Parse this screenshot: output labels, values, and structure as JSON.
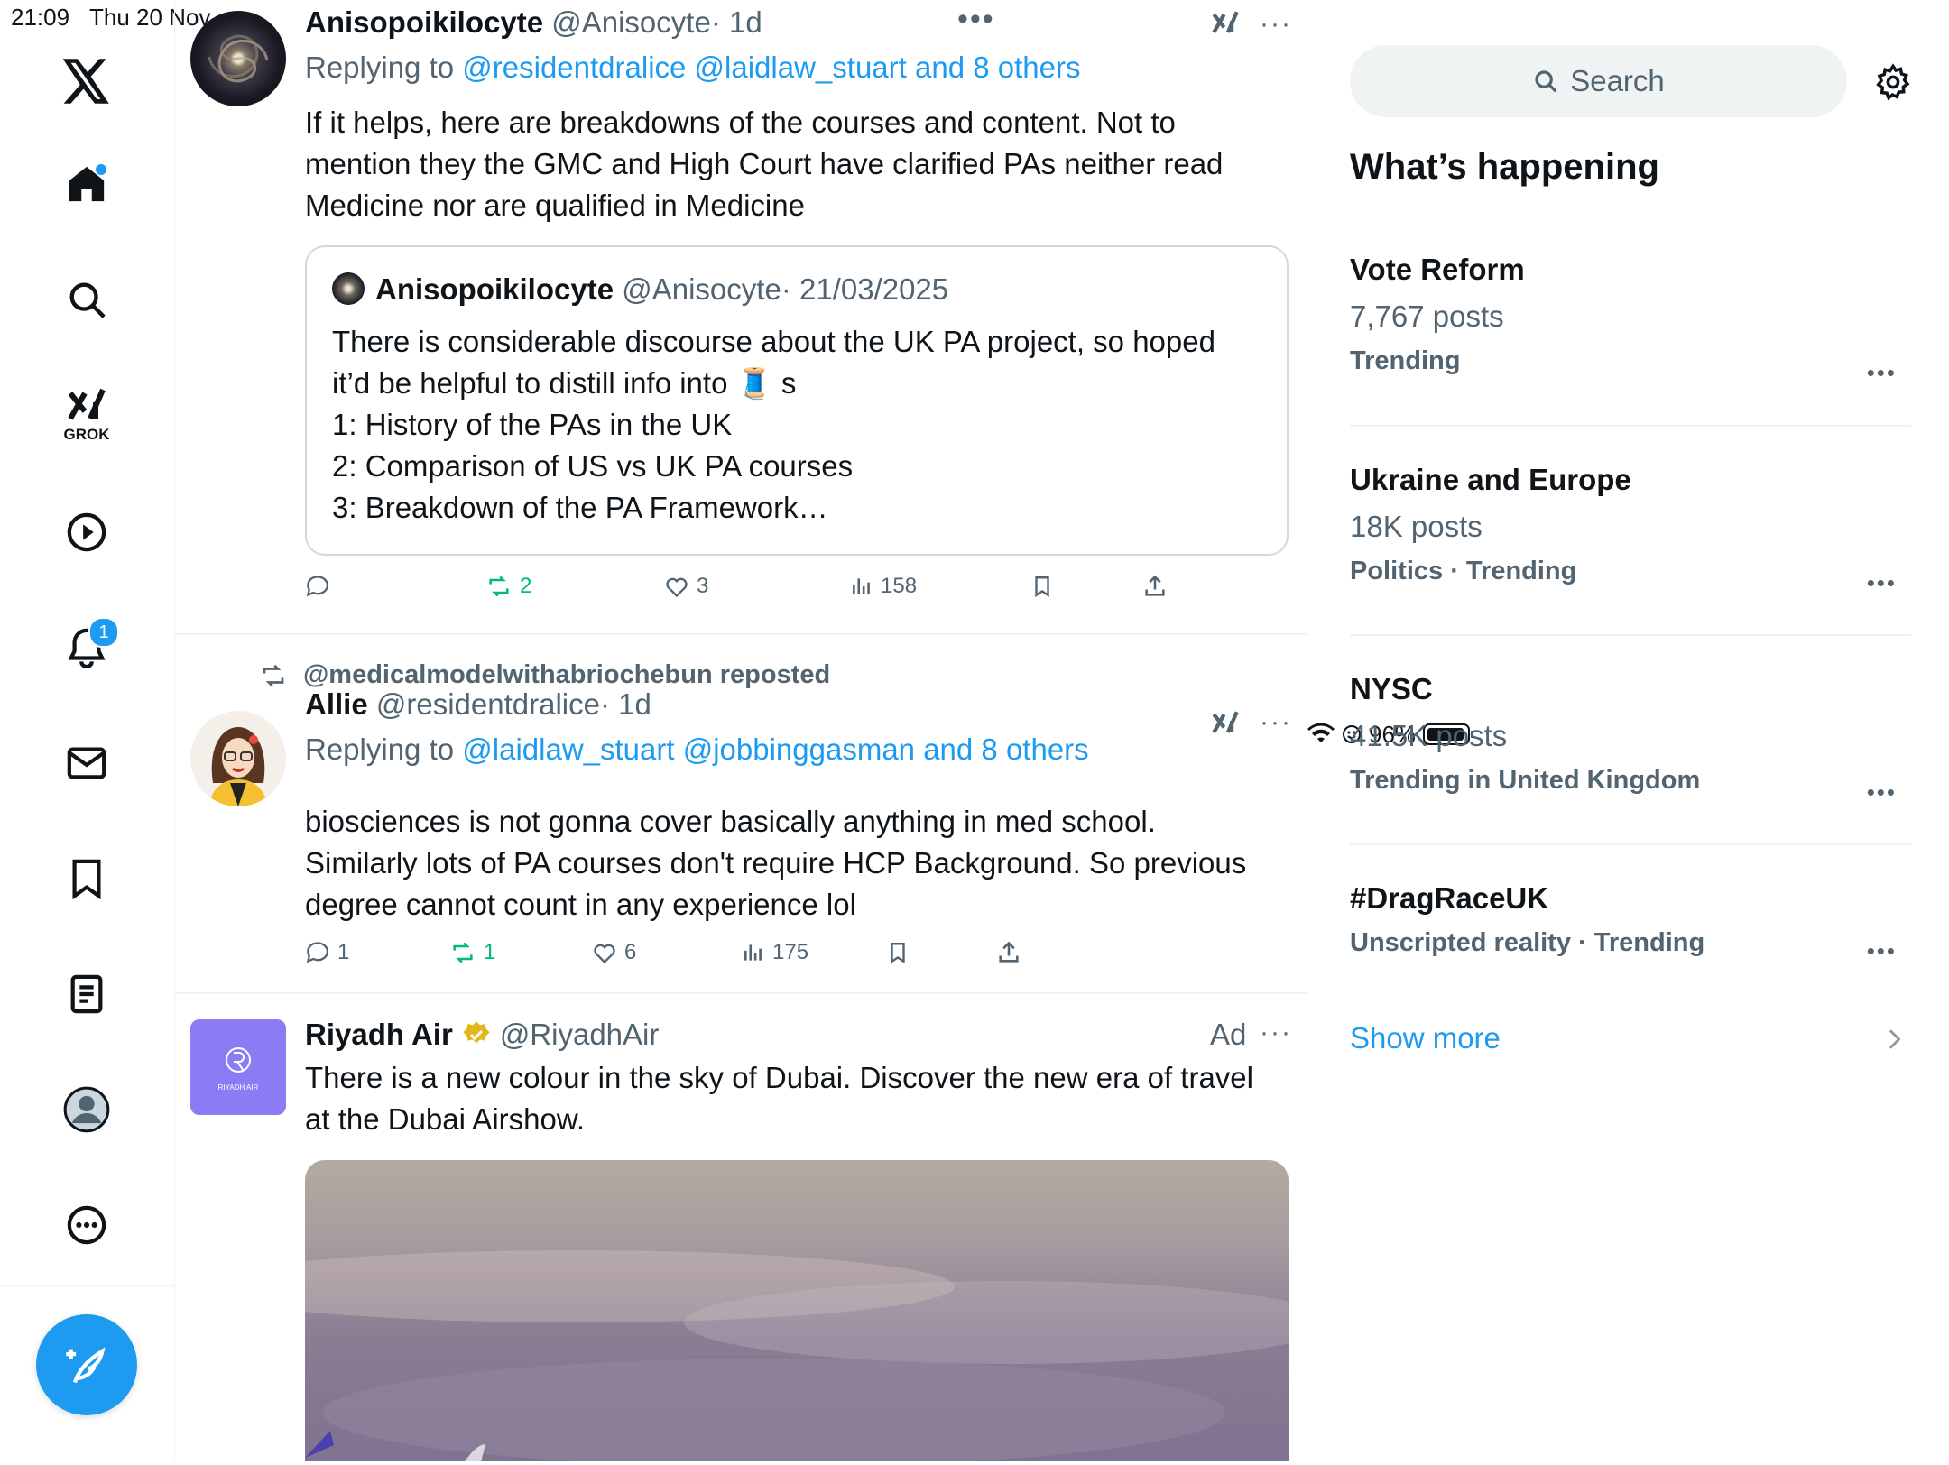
{
  "status_bar": {
    "time": "21:09",
    "date": "Thu 20 Nov",
    "battery": "96%"
  },
  "nav": {
    "grok_label": "GROK",
    "notifications_badge": "1"
  },
  "posts": [
    {
      "name": "Anisopoikilocyte",
      "handle": "@Anisocyte",
      "time": "· 1d",
      "replying_prefix": "Replying to ",
      "replying_to": "@residentdralice @laidlaw_stuart and 8 others",
      "text_lines": [
        "If it helps, here are breakdowns of the courses and content. Not to",
        "mention they the GMC and High Court have clarified PAs neither read",
        "Medicine nor are qualified in Medicine"
      ],
      "quote": {
        "name": "Anisopoikilocyte",
        "handle": "@Anisocyte",
        "time": "· 21/03/2025",
        "lines": [
          "There is considerable discourse about the UK PA project, so hoped",
          "it’d be helpful to distill info into 🧵 s",
          "1: History of the PAs in the UK",
          "2: Comparison of US vs UK PA courses",
          "3: Breakdown of the PA Framework…"
        ]
      },
      "stats": {
        "replies": "",
        "reposts": "2",
        "likes": "3",
        "views": "158"
      }
    },
    {
      "reposted_by": "@medicalmodelwithabriochebun reposted",
      "name": "Allie",
      "handle": "@residentdralice",
      "time": "· 1d",
      "replying_prefix": "Replying to ",
      "replying_to": "@laidlaw_stuart @jobbinggasman and 8 others",
      "text_lines": [
        "biosciences is not gonna cover basically anything in med school.",
        "Similarly lots of PA courses don't require HCP Background.  So previous",
        "degree cannot count in any experience lol"
      ],
      "stats": {
        "replies": "1",
        "reposts": "1",
        "likes": "6",
        "views": "175"
      }
    },
    {
      "name": "Riyadh Air",
      "handle": "@RiyadhAir",
      "ad_label": "Ad",
      "logo_text": "RIYADH AIR",
      "text_lines": [
        "There is a new colour in the sky of Dubai. Discover the new era of travel",
        "at the Dubai Airshow."
      ]
    }
  ],
  "sidebar": {
    "search_placeholder": "Search",
    "title": "What’s happening",
    "trends": [
      {
        "title": "Vote Reform",
        "posts": "7,767 posts",
        "context": "Trending"
      },
      {
        "title": "Ukraine and Europe",
        "posts": "18K posts",
        "context": "Politics · Trending"
      },
      {
        "title": "NYSC",
        "posts": "41.5K posts",
        "context": "Trending in United Kingdom"
      },
      {
        "title": "#DragRaceUK",
        "posts": "",
        "context": "Unscripted reality · Trending"
      }
    ],
    "show_more": "Show more"
  },
  "colors": {
    "accent": "#1d9bf0",
    "repost_green": "#00ba7c",
    "muted": "#536471"
  }
}
